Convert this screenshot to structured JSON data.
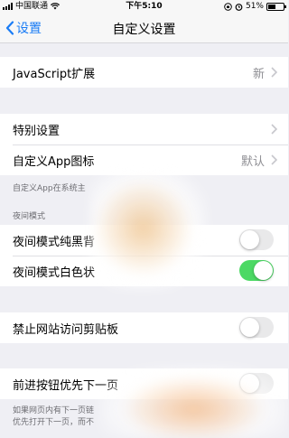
{
  "status_bar": {
    "carrier": "中国联通",
    "time": "下午5:10",
    "battery": "51%",
    "battery_level": 0.51
  },
  "nav": {
    "back_label": "设置",
    "title": "自定义设置"
  },
  "rows": {
    "js_extension": {
      "label": "JavaScript扩展",
      "value": "新"
    },
    "special_settings": {
      "label": "特别设置"
    },
    "custom_icon": {
      "label": "自定义App图标",
      "value": "默认"
    }
  },
  "notes": {
    "icon_note": "自定义App在系统主",
    "night_section": "夜间模式",
    "bottom_note_line1": "如果网页内有下一页链",
    "bottom_note_line2": "优先打开下一页，而不"
  },
  "toggles": {
    "night_black": {
      "label": "夜间模式纯黑背",
      "on": false
    },
    "night_white": {
      "label": "夜间模式白色状",
      "on": true
    },
    "block_clipboard": {
      "label": "禁止网站访问剪贴板",
      "on": false
    },
    "forward_next": {
      "label": "前进按钮优先下一页",
      "on": false
    }
  },
  "colors": {
    "accent": "#1a7cf5",
    "toggle_on": "#4cd964",
    "toggle_off": "#e9e9ea",
    "background": "#efeff4"
  }
}
